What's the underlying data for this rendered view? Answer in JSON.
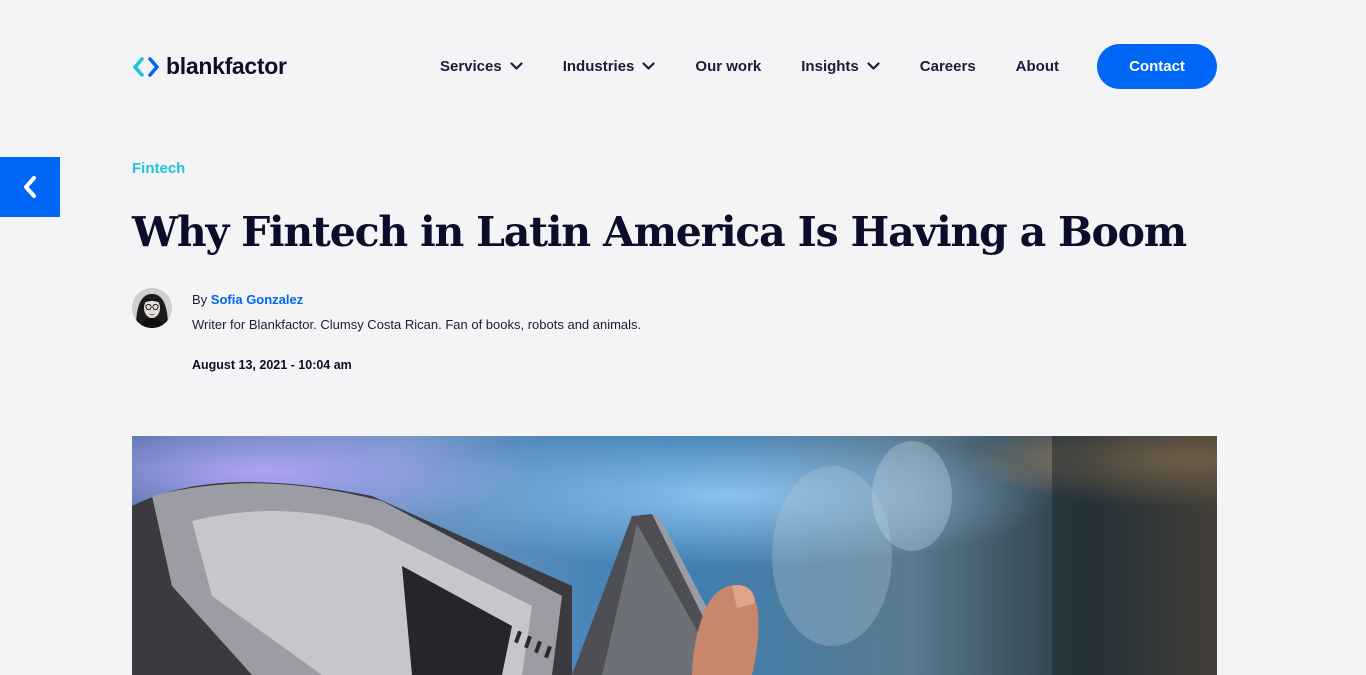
{
  "header": {
    "logo_text": "blankfactor",
    "nav": [
      {
        "label": "Services",
        "has_dropdown": true
      },
      {
        "label": "Industries",
        "has_dropdown": true
      },
      {
        "label": "Our work",
        "has_dropdown": false
      },
      {
        "label": "Insights",
        "has_dropdown": true
      },
      {
        "label": "Careers",
        "has_dropdown": false
      },
      {
        "label": "About",
        "has_dropdown": false
      }
    ],
    "contact_label": "Contact"
  },
  "article": {
    "category": "Fintech",
    "title": "Why Fintech in Latin America Is Having a Boom",
    "by_prefix": "By",
    "author": "Sofia Gonzalez",
    "bio": "Writer for Blankfactor. Clumsy Costa Rican. Fan of books, robots and animals.",
    "date": "August 13, 2021 - 10:04 am"
  },
  "colors": {
    "accent": "#0066f5",
    "category": "#1ec3d9",
    "logo_cyan": "#1ec3d9",
    "logo_blue": "#0066f5",
    "background": "#f4f4f7",
    "heading": "#0c0d2b"
  },
  "icons": {
    "back": "chevron-left-icon",
    "dropdown": "chevron-down-icon"
  }
}
